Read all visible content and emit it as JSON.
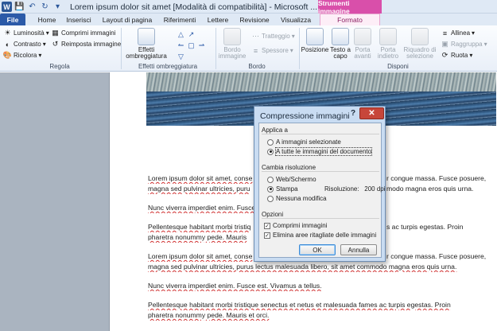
{
  "window": {
    "title": "Lorem ipsum dolor sit amet [Modalità di compatibilità] - Microsoft ...",
    "context_header": "Strumenti immagine",
    "qat": {
      "save_icon": "save-icon",
      "undo_icon": "undo-icon",
      "repeat_icon": "repeat-icon",
      "customize_icon": "customize-qat-icon"
    }
  },
  "tabs": [
    {
      "label": "File"
    },
    {
      "label": "Home"
    },
    {
      "label": "Inserisci"
    },
    {
      "label": "Layout di pagina"
    },
    {
      "label": "Riferimenti"
    },
    {
      "label": "Lettere"
    },
    {
      "label": "Revisione"
    },
    {
      "label": "Visualizza"
    },
    {
      "label": "Formato"
    }
  ],
  "ribbon": {
    "regola": {
      "label": "Regola",
      "luminosita": "Luminosità",
      "contrasto": "Contrasto",
      "ricolora": "Ricolora",
      "comprimi": "Comprimi immagini",
      "reimposta": "Reimposta immagine"
    },
    "effetti": {
      "label": "Effetti ombreggiatura",
      "button": "Effetti ombreggiatura"
    },
    "bordo": {
      "label": "Bordo",
      "bordo_immagine": "Bordo immagine",
      "tratteggio": "Tratteggio",
      "spessore": "Spessore"
    },
    "disponi": {
      "label": "Disponi",
      "posizione": "Posizione",
      "testo_a_capo": "Testo a capo",
      "porta_avanti": "Porta avanti",
      "porta_indietro": "Porta indietro",
      "riquadro": "Riquadro di selezione",
      "allinea": "Allinea",
      "raggruppa": "Raggruppa",
      "ruota": "Ruota"
    }
  },
  "document": {
    "paragraphs": [
      {
        "line1": "Lorem ipsum dolor sit amet, conse",
        "tail1": "r congue massa. Fusce posuere,",
        "line2": "magna sed pulvinar ultricies, puru",
        "tail2": "modo magna eros quis urna."
      },
      {
        "line1": "Nunc viverra imperdiet enim. Fusce",
        "tail1": ""
      },
      {
        "line1": "Pellentesque habitant morbi tristiq",
        "tail1": "s ac turpis egestas. Proin",
        "line2": "pharetra nonummy pede. Mauris",
        "tail2": ""
      },
      {
        "line1": "Lorem ipsum dolor sit amet, conse",
        "tail1": "r congue massa. Fusce posuere,",
        "line2": "magna sed pulvinar ultricies, purus lectus malesuada libero, sit amet commodo magna eros quis urna.",
        "tail2": ""
      },
      {
        "line1": "Nunc viverra imperdiet enim. Fusce est. Vivamus a tellus.",
        "tail1": ""
      },
      {
        "line1": "Pellentesque habitant morbi tristique senectus et netus et malesuada fames ac turpis egestas. Proin",
        "line2": "pharetra nonummy pede. Mauris et orci."
      }
    ]
  },
  "dialog": {
    "title": "Compressione immagini",
    "help": "?",
    "close": "✕",
    "applica_section": "Applica a",
    "opt_selected": "A immagini selezionate",
    "opt_all": "A tutte le immagini del documento",
    "risoluzione_section": "Cambia risoluzione",
    "opt_web": "Web/Schermo",
    "opt_stampa": "Stampa",
    "opt_nessuna": "Nessuna modifica",
    "risoluzione_label": "Risoluzione:",
    "risoluzione_value": "200 dpi",
    "opzioni_section": "Opzioni",
    "chk_comprimi": "Comprimi immagini",
    "chk_elimina": "Elimina aree ritagliate delle immagini",
    "ok": "OK",
    "annulla": "Annulla"
  }
}
